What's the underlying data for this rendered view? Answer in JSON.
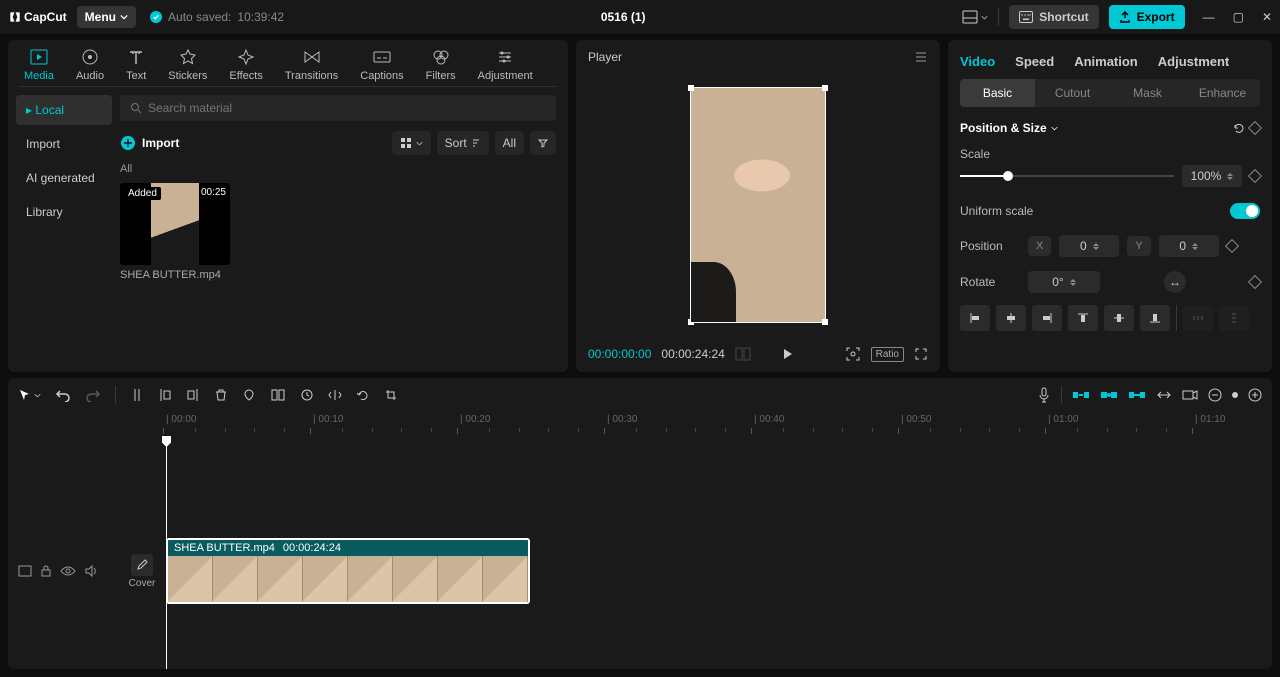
{
  "titlebar": {
    "logo": "CapCut",
    "menu": "Menu",
    "autosave_label": "Auto saved:",
    "autosave_time": "10:39:42",
    "project": "0516 (1)",
    "shortcut": "Shortcut",
    "export": "Export"
  },
  "media_tabs": [
    "Media",
    "Audio",
    "Text",
    "Stickers",
    "Effects",
    "Transitions",
    "Captions",
    "Filters",
    "Adjustment"
  ],
  "media_side": [
    "Local",
    "Import",
    "AI generated",
    "Library"
  ],
  "search_placeholder": "Search material",
  "import_label": "Import",
  "sort_label": "Sort",
  "all_label": "All",
  "section_all": "All",
  "clip": {
    "added": "Added",
    "duration": "00:25",
    "name": "SHEA BUTTER.mp4"
  },
  "player": {
    "title": "Player",
    "tc_current": "00:00:00:00",
    "tc_total": "00:00:24:24",
    "ratio": "Ratio"
  },
  "inspector": {
    "tabs": [
      "Video",
      "Speed",
      "Animation",
      "Adjustment"
    ],
    "subtabs": [
      "Basic",
      "Cutout",
      "Mask",
      "Enhance"
    ],
    "section": "Position & Size",
    "scale_label": "Scale",
    "scale_value": "100%",
    "uniform_label": "Uniform scale",
    "position_label": "Position",
    "pos_x": "0",
    "pos_y": "0",
    "rotate_label": "Rotate",
    "rotate_value": "0°"
  },
  "timeline": {
    "cover": "Cover",
    "clip_name": "SHEA BUTTER.mp4",
    "clip_dur": "00:00:24:24",
    "ticks": [
      "00:00",
      "00:10",
      "00:20",
      "00:30",
      "00:40",
      "00:50",
      "01:00",
      "01:10"
    ]
  }
}
